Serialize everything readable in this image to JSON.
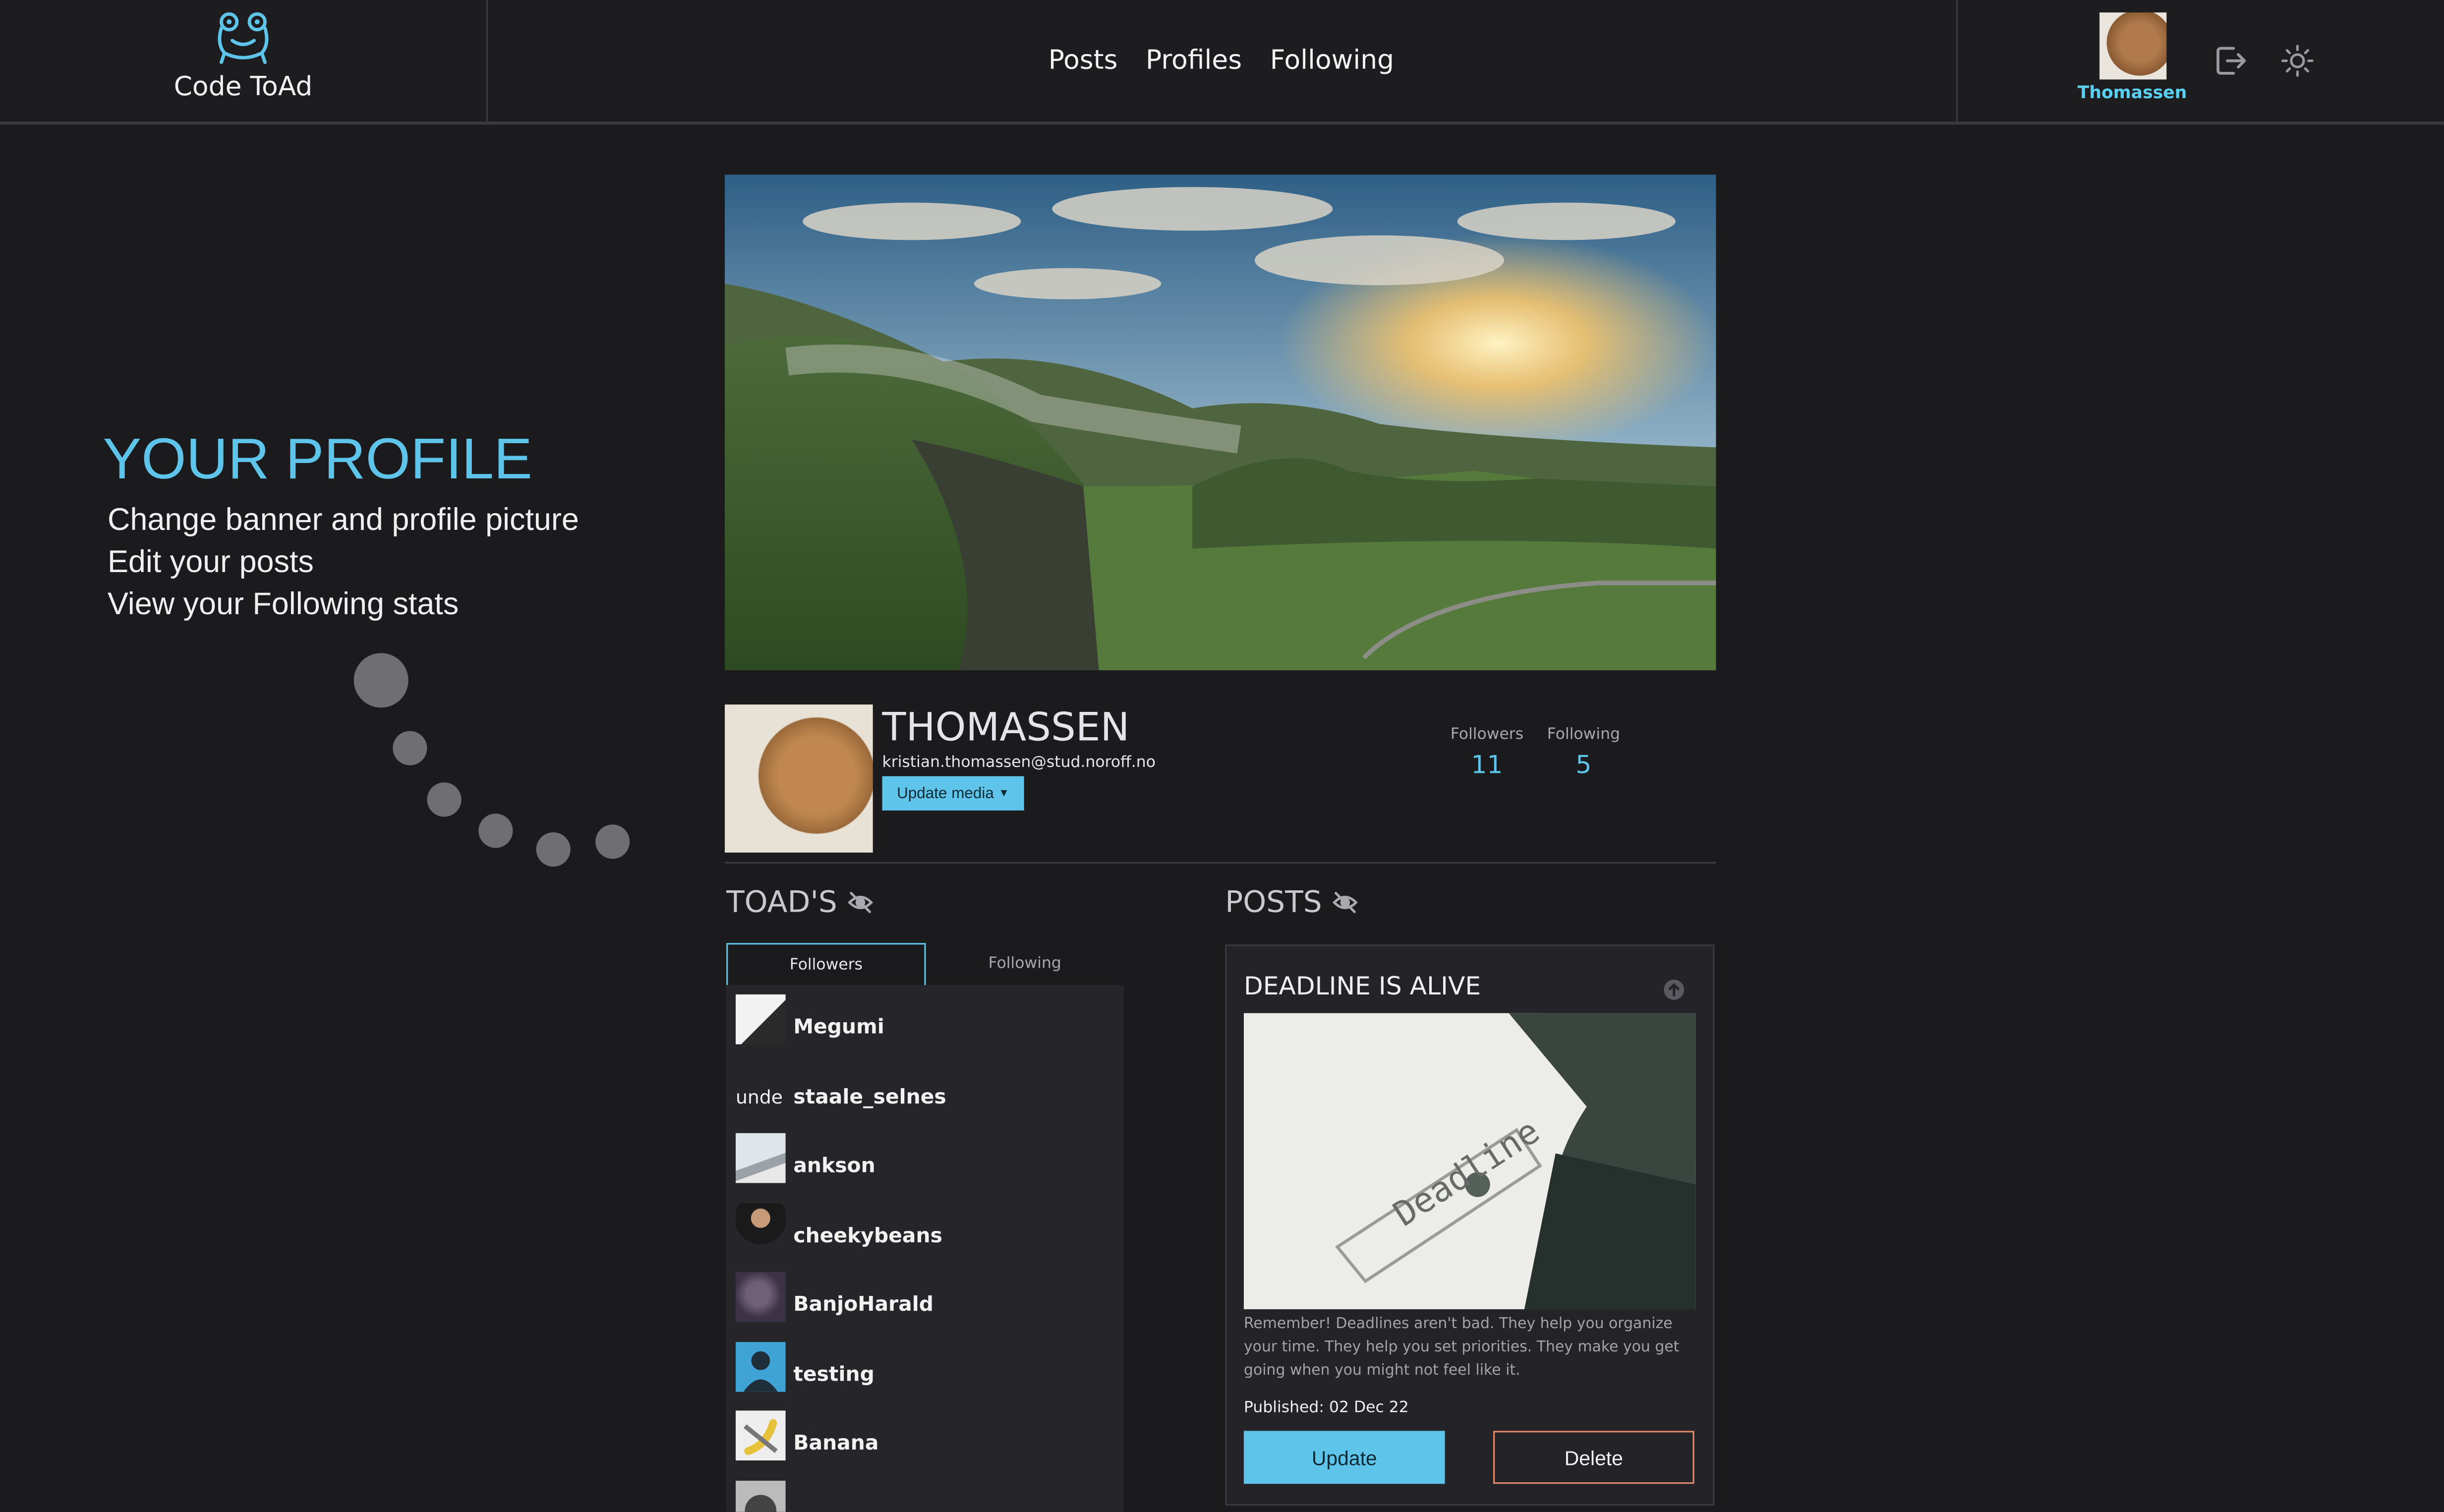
{
  "brand": {
    "name": "Code ToAd"
  },
  "nav": {
    "posts": "Posts",
    "profiles": "Profiles",
    "following": "Following"
  },
  "user": {
    "name": "Thomassen"
  },
  "icons": {
    "logo": "frog-logo-icon",
    "logout": "logout-icon",
    "theme": "sun-icon",
    "hidden": "eye-slash-icon",
    "scroll_top": "arrow-up-circle-icon"
  },
  "colors": {
    "accent": "#5ec4ea",
    "background": "#1b1b1e",
    "delete_border": "#e08a6a"
  },
  "intro": {
    "title": "YOUR PROFILE",
    "lines": [
      "Change banner and profile picture",
      "Edit your posts",
      "View your Following stats"
    ]
  },
  "profile": {
    "name": "THOMASSEN",
    "email": "kristian.thomassen@stud.noroff.no",
    "update_media": "Update media",
    "followers_label": "Followers",
    "followers_count": "11",
    "following_label": "Following",
    "following_count": "5"
  },
  "toads": {
    "heading": "TOAD'S",
    "tab_followers": "Followers",
    "tab_following": "Following",
    "broken_img_alt": "unde",
    "list": [
      "Megumi",
      "staale_selnes",
      "ankson",
      "cheekybeans",
      "BanjoHarald",
      "testing",
      "Banana",
      ""
    ]
  },
  "posts": {
    "heading": "POSTS",
    "card": {
      "title": "DEADLINE IS ALIVE",
      "image_text": "Deadline",
      "body": "Remember! Deadlines aren't bad. They help you organize your time. They help you set priorities. They make you get going when you might not feel like it.",
      "published": "Published: 02 Dec 22",
      "update_label": "Update",
      "delete_label": "Delete"
    }
  }
}
